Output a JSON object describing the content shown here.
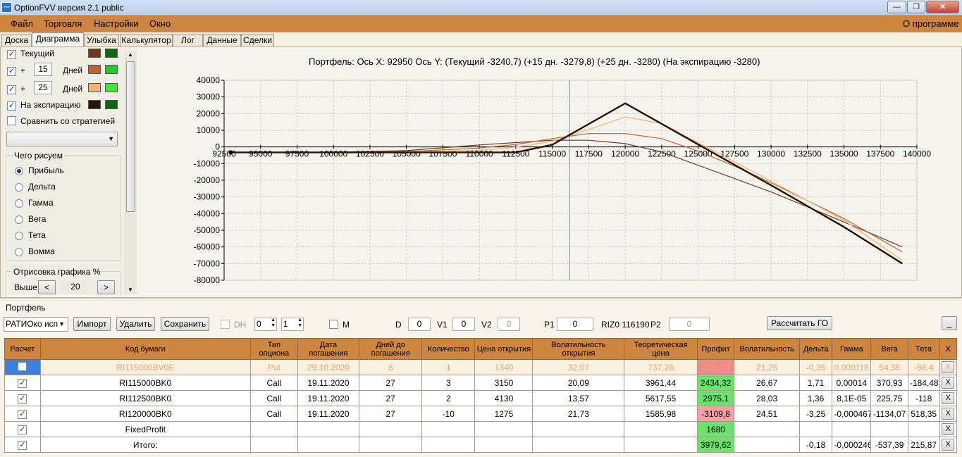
{
  "window": {
    "title": "OptionFVV версия 2.1 public",
    "minimize": "—",
    "maximize": "❐",
    "close": "✕"
  },
  "menu": {
    "items": [
      "Файл",
      "Торговля",
      "Настройки",
      "Окно"
    ],
    "about": "О программе"
  },
  "tabs": [
    "Доска",
    "Диаграмма",
    "Улыбка",
    "Калькулятор",
    "Лог",
    "Данные",
    "Сделки"
  ],
  "active_tab": "Диаграмма",
  "left": {
    "current": {
      "label": "Текущий",
      "checked": true,
      "colors": [
        "#6b3a1e",
        "#0a6a12"
      ]
    },
    "plus1": {
      "prefix": "+",
      "value": "15",
      "unit": "Дней",
      "checked": true,
      "colors": [
        "#c0642a",
        "#22cc22"
      ]
    },
    "plus2": {
      "prefix": "+",
      "value": "25",
      "unit": "Дней",
      "checked": true,
      "colors": [
        "#f5b36b",
        "#33ee33"
      ]
    },
    "expiry": {
      "label": "На экспирацию",
      "checked": true,
      "colors": [
        "#2a1406",
        "#0a6a12"
      ]
    },
    "compare": {
      "label": "Сравнить со стратегией",
      "checked": false
    },
    "strategy_select": "",
    "draw_group": {
      "title": "Чего рисуем",
      "options": [
        "Прибыль",
        "Дельта",
        "Гамма",
        "Вега",
        "Тета",
        "Вомма"
      ],
      "selected": "Прибыль"
    },
    "render_group": {
      "title": "Отрисовка графика %",
      "above_label": "Выше",
      "value": "20",
      "dec": "<",
      "inc": ">"
    }
  },
  "chart_data": {
    "type": "line",
    "title": "Портфель: Ось X: 92950 Ось Y:  (Текущий -3240,7)  (+15 дн. -3279,8)  (+25 дн. -3280)  (На экспирацию -3280)",
    "xlim": [
      92500,
      140000
    ],
    "ylim": [
      -80000,
      40000
    ],
    "x_ticks": [
      "92500",
      "95000",
      "97500",
      "100000",
      "102500",
      "105000",
      "107500",
      "110000",
      "112500",
      "115000",
      "117500",
      "120000",
      "122500",
      "125000",
      "127500",
      "130000",
      "132500",
      "135000",
      "137500",
      "140000"
    ],
    "y_ticks": [
      "40000",
      "30000",
      "20000",
      "10000",
      "0",
      "-10000",
      "-20000",
      "-30000",
      "-40000",
      "-50000",
      "-60000",
      "-70000",
      "-80000"
    ],
    "vline_x": 116190,
    "grid": true,
    "series": [
      {
        "color": "#6b3a1e",
        "points": [
          [
            93000,
            -3240
          ],
          [
            100000,
            -3200
          ],
          [
            105000,
            -2200
          ],
          [
            110000,
            1200
          ],
          [
            115000,
            4000
          ],
          [
            117500,
            4000
          ],
          [
            120000,
            2000
          ],
          [
            122500,
            -3000
          ],
          [
            125000,
            -11000
          ],
          [
            127500,
            -19000
          ],
          [
            130000,
            -27000
          ],
          [
            135000,
            -45000
          ],
          [
            139000,
            -60000
          ]
        ]
      },
      {
        "color": "#c0642a",
        "points": [
          [
            93000,
            -3280
          ],
          [
            100000,
            -3250
          ],
          [
            105000,
            -2800
          ],
          [
            110000,
            -700
          ],
          [
            112500,
            1500
          ],
          [
            115000,
            5000
          ],
          [
            117500,
            8000
          ],
          [
            120000,
            8000
          ],
          [
            122500,
            5000
          ],
          [
            125000,
            -2500
          ],
          [
            127500,
            -11500
          ],
          [
            130000,
            -21500
          ],
          [
            135000,
            -43000
          ],
          [
            139000,
            -63000
          ]
        ]
      },
      {
        "color": "#f5b36b",
        "points": [
          [
            93000,
            -3280
          ],
          [
            100000,
            -3270
          ],
          [
            105000,
            -3100
          ],
          [
            110000,
            -2000
          ],
          [
            112500,
            -200
          ],
          [
            115000,
            3500
          ],
          [
            117500,
            10500
          ],
          [
            120000,
            18000
          ],
          [
            122500,
            14000
          ],
          [
            125000,
            2500
          ],
          [
            127500,
            -9000
          ],
          [
            130000,
            -20500
          ],
          [
            135000,
            -44000
          ],
          [
            139000,
            -68000
          ]
        ]
      },
      {
        "color": "#2a1406",
        "points": [
          [
            93000,
            -3280
          ],
          [
            112500,
            -3280
          ],
          [
            115000,
            1300
          ],
          [
            120000,
            26200
          ],
          [
            125000,
            1500
          ],
          [
            130000,
            -23000
          ],
          [
            135000,
            -48000
          ],
          [
            139000,
            -70000
          ]
        ]
      }
    ]
  },
  "portfolio": {
    "title": "Портфель",
    "account": "РАТИОко исп",
    "import": "Импорт",
    "delete": "Удалить",
    "save": "Сохранить",
    "dh": "DH",
    "spin1": "0",
    "spin2": "1",
    "m": "M",
    "d_label": "D",
    "d_value": "0",
    "v1_label": "V1",
    "v1_value": "0",
    "v2_label": "V2",
    "v2_value": "0",
    "p1_label": "P1",
    "p1_value": "0",
    "riz": "RIZ0 116190",
    "p2_label": "P2",
    "p2_value": "0",
    "calc_go": "Рассчитать ГО",
    "min": "_"
  },
  "table": {
    "headers": [
      "Расчет",
      "Код бумаги",
      "Тип опциона",
      "Дата погашения",
      "Дней до погашения",
      "Количество",
      "Цена открытия",
      "Волатильность открытия",
      "Теоретическая цена",
      "Профит",
      "Волатильность",
      "Дельта",
      "Гамма",
      "Вега",
      "Тета",
      "X"
    ],
    "rows": [
      {
        "checked": false,
        "dim": true,
        "cells": [
          "RI115000BV0E",
          "Put",
          "29.10.2020",
          "6",
          "1",
          "1340",
          "32,07",
          "737,26",
          "-602,74",
          "21,25",
          "-0,35",
          "0,000118",
          "54,36",
          "-98,4"
        ],
        "profit_color": "red"
      },
      {
        "checked": true,
        "dim": false,
        "cells": [
          "RI115000BK0",
          "Call",
          "19.11.2020",
          "27",
          "3",
          "3150",
          "20,09",
          "3961,44",
          "2434,32",
          "26,67",
          "1,71",
          "0,00014",
          "370,93",
          "-184,48"
        ],
        "profit_color": "green"
      },
      {
        "checked": true,
        "dim": false,
        "cells": [
          "RI112500BK0",
          "Call",
          "19.11.2020",
          "27",
          "2",
          "4130",
          "13,57",
          "5617,55",
          "2975,1",
          "28,03",
          "1,36",
          "8,1E-05",
          "225,75",
          "-118"
        ],
        "profit_color": "green"
      },
      {
        "checked": true,
        "dim": false,
        "cells": [
          "RI120000BK0",
          "Call",
          "19.11.2020",
          "27",
          "-10",
          "1275",
          "21,73",
          "1585,98",
          "-3109,8",
          "24,51",
          "-3,25",
          "-0,000467",
          "-1134,07",
          "518,35"
        ],
        "profit_color": "red"
      },
      {
        "checked": true,
        "dim": false,
        "cells": [
          "FixedProfit",
          "",
          "",
          "",
          "",
          "",
          "",
          "",
          "1680",
          "",
          "",
          "",
          "",
          ""
        ],
        "profit_color": "green"
      },
      {
        "checked": true,
        "dim": false,
        "cells": [
          "Итого:",
          "",
          "",
          "",
          "",
          "",
          "",
          "",
          "3979,62",
          "",
          "-0,18",
          "-0,000246",
          "-537,39",
          "215,87"
        ],
        "profit_color": "green"
      }
    ],
    "x_button": "X"
  }
}
